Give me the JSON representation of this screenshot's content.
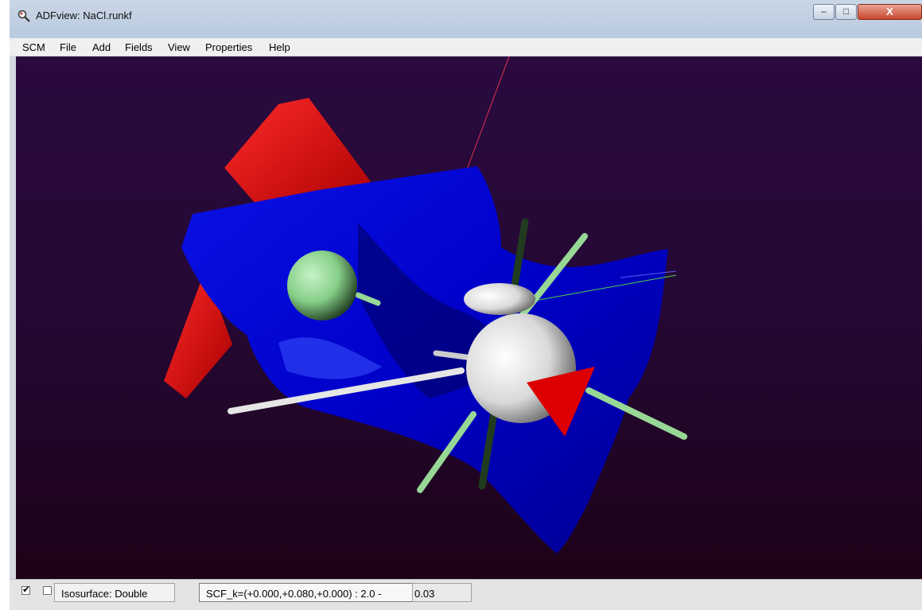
{
  "window": {
    "title": "ADFview: NaCl.runkf",
    "controls": {
      "minimize": "–",
      "maximize": "□",
      "close": "X"
    }
  },
  "menu": {
    "items": [
      {
        "label": "SCM"
      },
      {
        "label": "File"
      },
      {
        "label": "Add"
      },
      {
        "label": "Fields"
      },
      {
        "label": "View"
      },
      {
        "label": "Properties"
      },
      {
        "label": "Help"
      }
    ]
  },
  "scene": {
    "background_top": "#2a0a3f",
    "background_bottom": "#1d0218",
    "positive_lobe_color": "#d80000",
    "negative_lobe_color": "#0000dd",
    "chlorine_atom_color": "#8fd492",
    "sodium_atom_color": "#eeeeee"
  },
  "status": {
    "checkbox_visible_checked": true,
    "checkbox_second_checked": false,
    "isosurface_label": "Isosurface: Double",
    "field_label": "SCF_k=(+0.000,+0.080,+0.000) :  2.0  -",
    "iso_value": "0.03"
  }
}
